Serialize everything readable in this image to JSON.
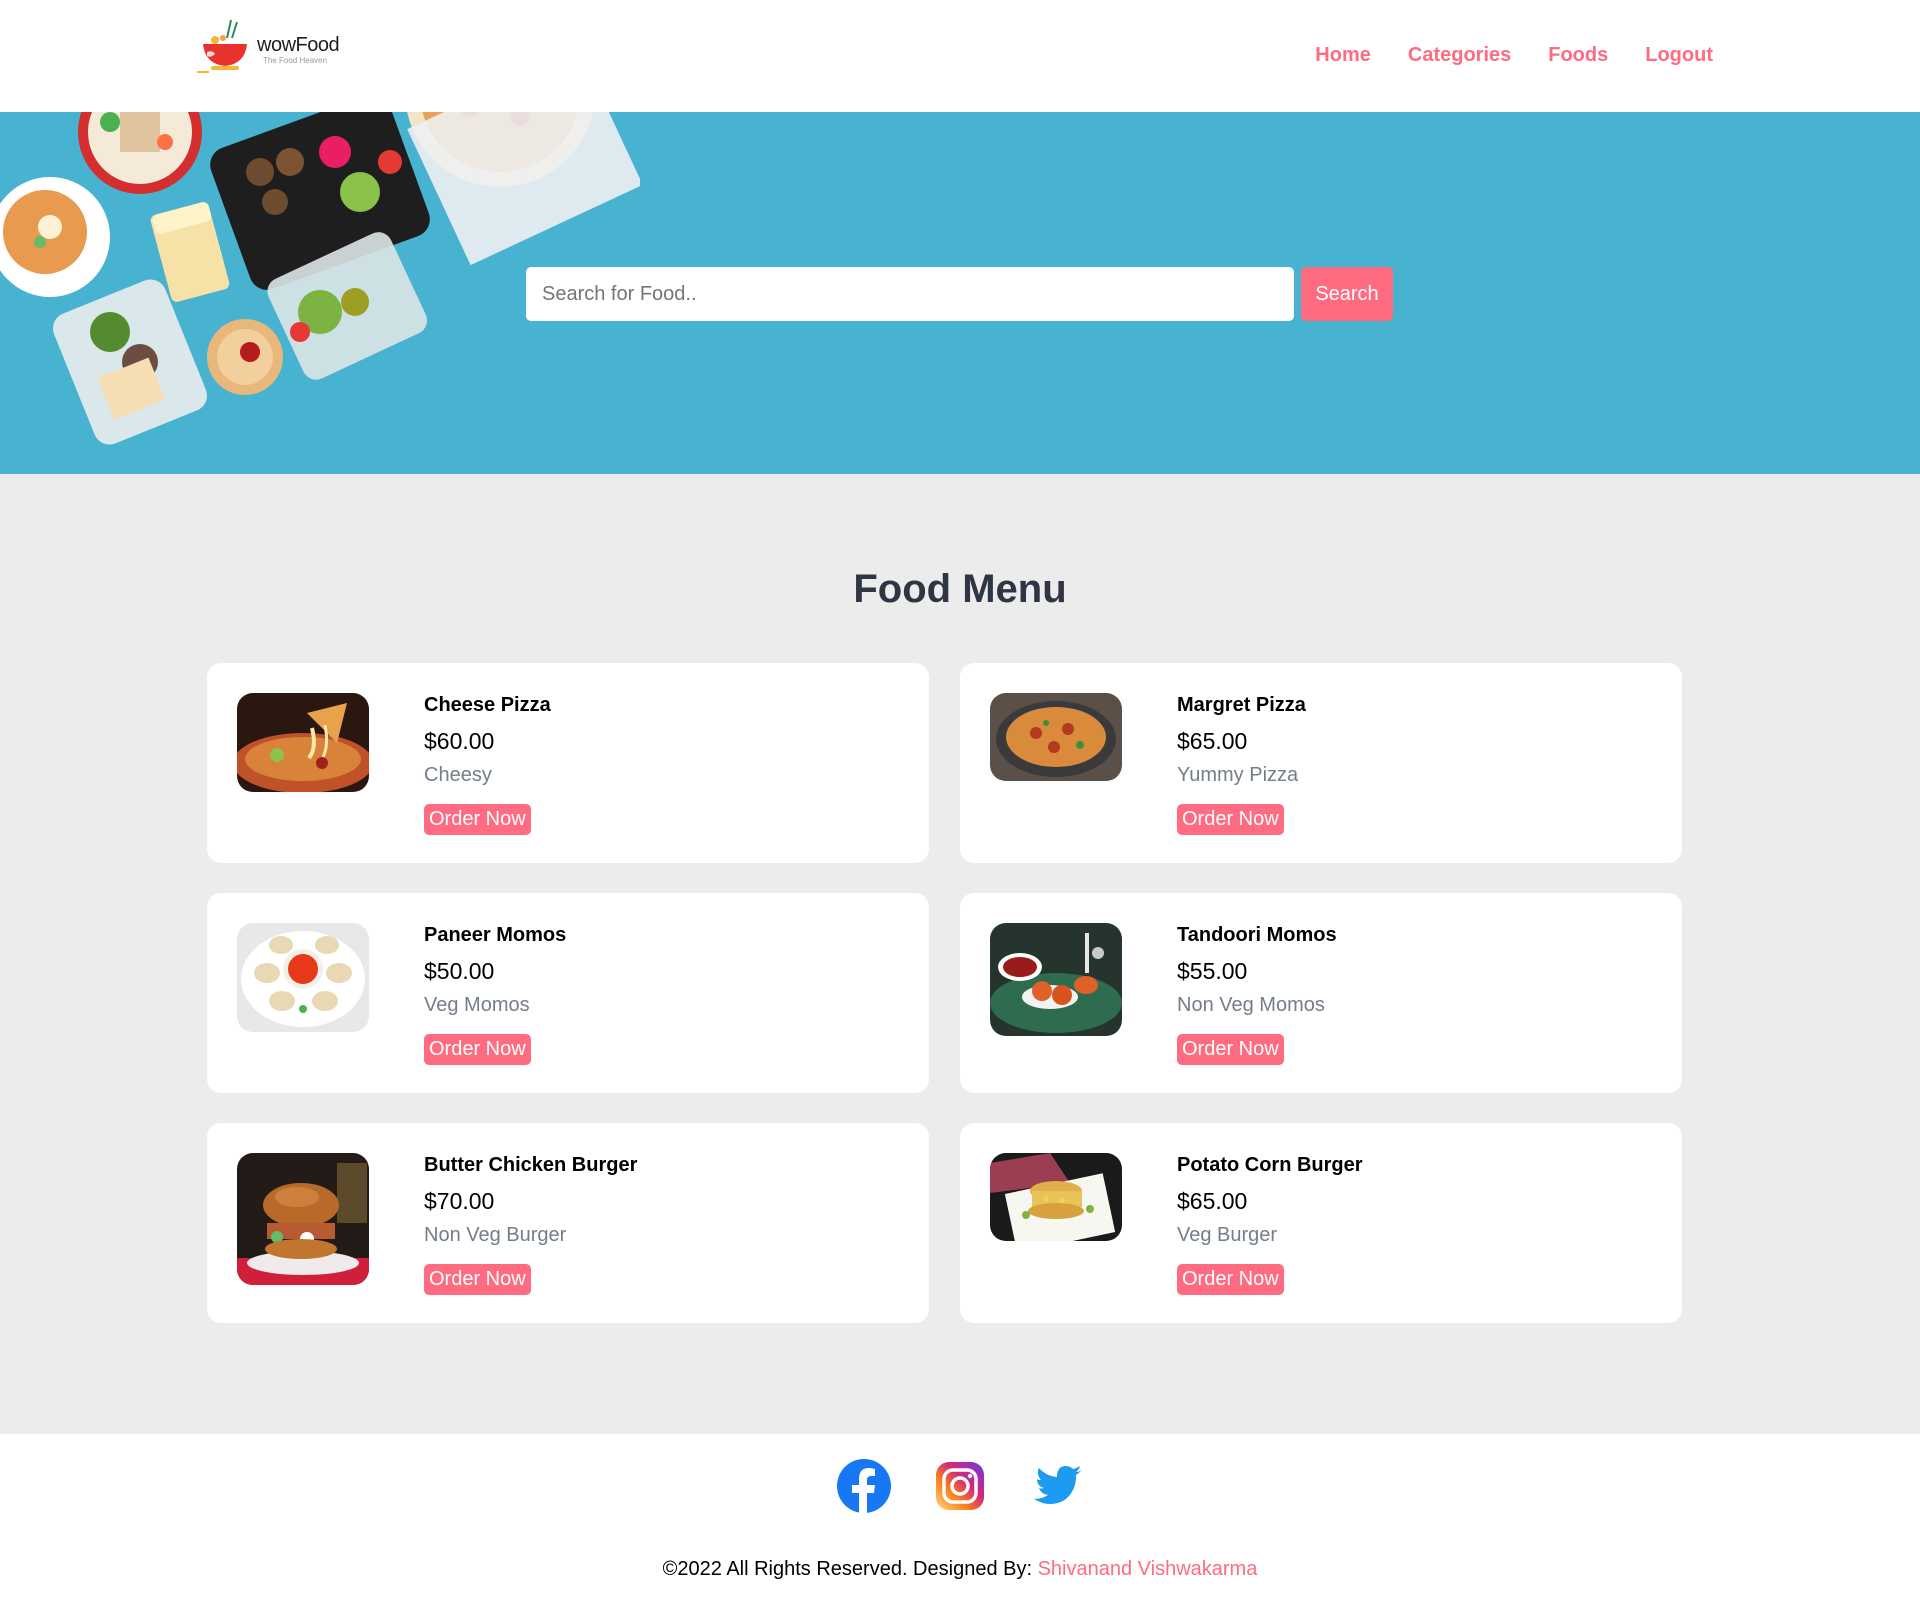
{
  "brand": {
    "name": "wowFood",
    "tagline": "The Food Heaven"
  },
  "nav": {
    "items": [
      "Home",
      "Categories",
      "Foods",
      "Logout"
    ]
  },
  "search": {
    "placeholder": "Search for Food..",
    "button_label": "Search"
  },
  "menu": {
    "title": "Food Menu",
    "items": [
      {
        "name": "Cheese Pizza",
        "price": "$60.00",
        "description": "Cheesy",
        "order_label": "Order Now"
      },
      {
        "name": "Margret Pizza",
        "price": "$65.00",
        "description": "Yummy Pizza",
        "order_label": "Order Now"
      },
      {
        "name": "Paneer Momos",
        "price": "$50.00",
        "description": "Veg Momos",
        "order_label": "Order Now"
      },
      {
        "name": "Tandoori Momos",
        "price": "$55.00",
        "description": "Non Veg Momos",
        "order_label": "Order Now"
      },
      {
        "name": "Butter Chicken Burger",
        "price": "$70.00",
        "description": "Non Veg Burger",
        "order_label": "Order Now"
      },
      {
        "name": "Potato Corn Burger",
        "price": "$65.00",
        "description": "Veg Burger",
        "order_label": "Order Now"
      }
    ]
  },
  "footer": {
    "social": [
      "facebook-icon",
      "instagram-icon",
      "twitter-icon"
    ],
    "copyright_prefix": "©2022 All Rights Reserved. Designed By: ",
    "designer": "Shivanand Vishwakarma"
  },
  "colors": {
    "accent": "#ff6b81",
    "hero_bg": "#48b2d1",
    "page_bg": "#ececec",
    "heading": "#2f3542",
    "muted": "#747d8c"
  }
}
